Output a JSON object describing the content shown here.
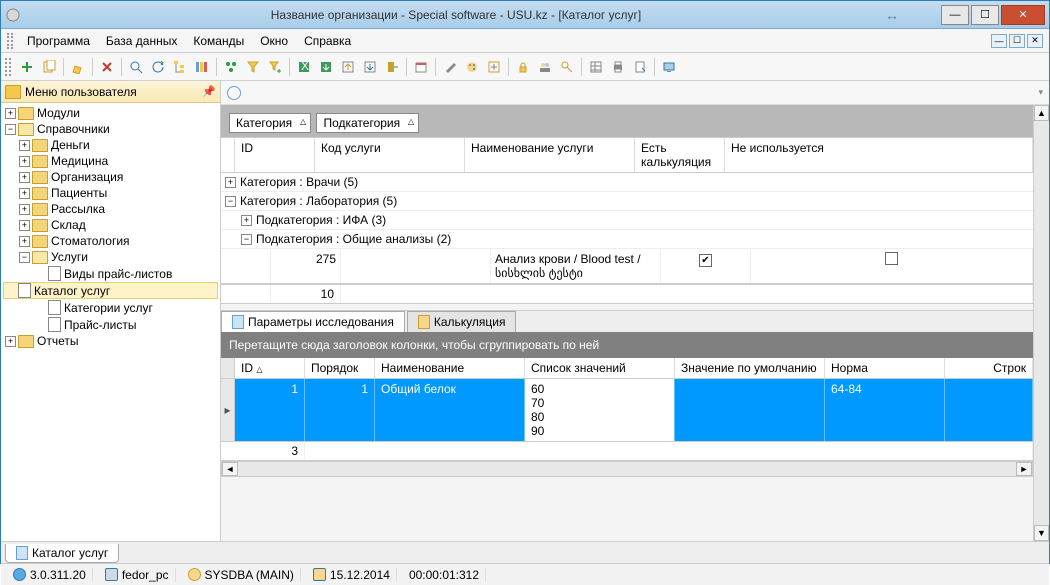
{
  "window": {
    "title": "Название организации - Special software - USU.kz - [Каталог услуг]",
    "resize_icon": "↔",
    "min": "—",
    "max": "☐",
    "close": "✕"
  },
  "menu": {
    "items": [
      "Программа",
      "База данных",
      "Команды",
      "Окно",
      "Справка"
    ],
    "mdi": [
      "—",
      "☐",
      "✕"
    ]
  },
  "sidebar": {
    "title": "Меню пользователя",
    "pin": "📌",
    "tree": {
      "modules": "Модули",
      "refs": "Справочники",
      "money": "Деньги",
      "medicine": "Медицина",
      "org": "Организация",
      "patients": "Пациенты",
      "mailing": "Рассылка",
      "warehouse": "Склад",
      "dental": "Стоматология",
      "services": "Услуги",
      "price_types": "Виды прайс-листов",
      "catalog": "Каталог услуг",
      "categories": "Категории услуг",
      "pricelists": "Прайс-листы",
      "reports": "Отчеты"
    }
  },
  "grid1": {
    "group_category": "Категория",
    "group_subcategory": "Подкатегория",
    "cols": {
      "id": "ID",
      "code": "Код услуги",
      "name": "Наименование услуги",
      "has_calc": "Есть калькуляция",
      "unused": "Не используется"
    },
    "groups": {
      "g1": "Категория : Врачи (5)",
      "g2": "Категория : Лаборатория (5)",
      "g2a": "Подкатегория : ИФА (3)",
      "g2b": "Подкатегория : Общие анализы (2)"
    },
    "row": {
      "id": "275",
      "name": "Анализ крови / Blood test / სისხლის ტესტი",
      "check1": "✔",
      "check2": ""
    },
    "foot_total": "10"
  },
  "tabs2": {
    "research": "Параметры исследования",
    "calc": "Калькуляция"
  },
  "grid2": {
    "group_hint": "Перетащите сюда заголовок колонки, чтобы сгруппировать по ней",
    "cols": {
      "id": "ID",
      "order": "Порядок",
      "name": "Наименование",
      "values": "Список значений",
      "default": "Значение по умолчанию",
      "norm": "Норма",
      "row": "Строк"
    },
    "row": {
      "id": "1",
      "order": "1",
      "name": "Общий белок",
      "values": "60\n70\n80\n90",
      "default": "",
      "norm": "64-84"
    },
    "foot_total": "3"
  },
  "bottom_tab": "Каталог услуг",
  "status": {
    "version": "3.0.311.20",
    "pc": "fedor_pc",
    "user": "SYSDBA (MAIN)",
    "date": "15.12.2014",
    "time": "00:00:01:312"
  }
}
